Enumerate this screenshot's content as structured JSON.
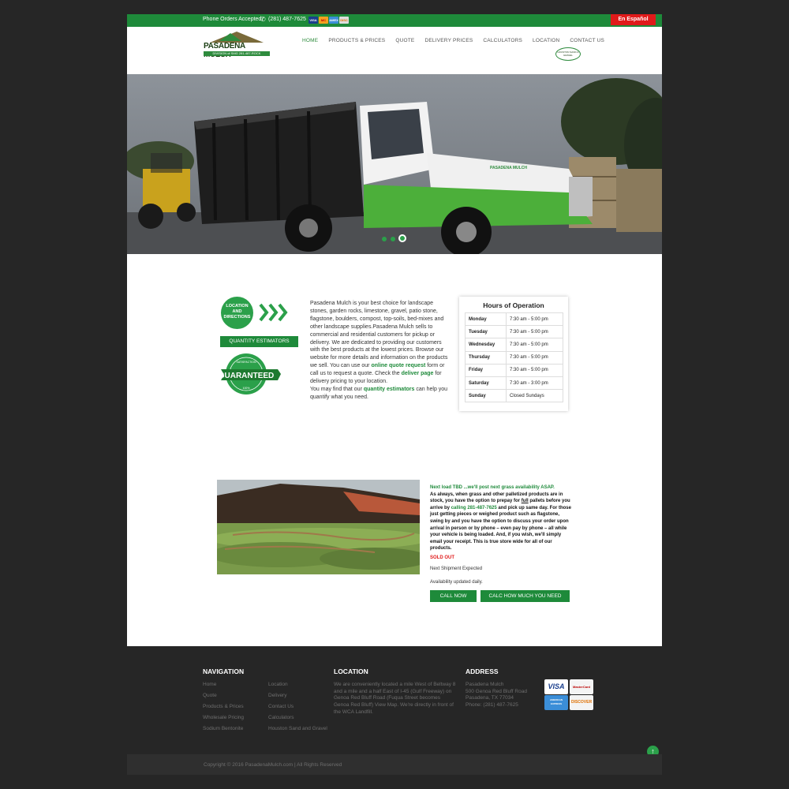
{
  "topbar": {
    "phone_label": "Phone Orders Accepted",
    "phone_number": "(281) 487-7625",
    "cards": [
      "VISA",
      "MC",
      "AMEX",
      "DISC"
    ],
    "spanish_link": "En Español"
  },
  "logo": {
    "name": "PASADENA MULCH",
    "sub": "DIVISION of SMG   281-487-ROCK"
  },
  "nav": {
    "items": [
      "HOME",
      "PRODUCTS & PRICES",
      "QUOTE",
      "DELIVERY PRICES",
      "CALCULATORS",
      "LOCATION",
      "CONTACT US"
    ],
    "badge": "HOUSTON SAND & GRAVEL"
  },
  "hero": {
    "truck_label": "PASADENA MULCH",
    "slides_count": 3,
    "active_slide": 3
  },
  "intro": {
    "location_button": "LOCATION AND DIRECTIONS",
    "quantity_button": "QUANTITY ESTIMATORS",
    "seal_top": "SATISFACTION",
    "seal_main": "GUARANTEED",
    "seal_bottom": "100%",
    "about_1": "Pasadena Mulch is your best choice for landscape stones, garden rocks, limestone, gravel, patio stone, flagstone, boulders, compost, top-soils, bed-mixes and other landscape supplies.Pasadena Mulch sells to commercial and residential customers for pickup or delivery. We are dedicated to providing our customers with the best products at the lowest prices. Browse our website for more details and information on the products we sell. You can use our ",
    "about_link_quote": "online quote request",
    "about_2": " form or call us to request a quote. Check the ",
    "about_link_deliver": "deliver page",
    "about_3": " for delivery pricing to your location.",
    "about_4": "You may find that our ",
    "about_link_qty": "quantity estimators",
    "about_5": " can help you quantify what you need."
  },
  "hours": {
    "title": "Hours of Operation",
    "rows": [
      {
        "day": "Monday",
        "time": "7:30 am - 5:00 pm"
      },
      {
        "day": "Tuesday",
        "time": "7:30 am - 5:00 pm"
      },
      {
        "day": "Wednesday",
        "time": "7:30 am - 5:00 pm"
      },
      {
        "day": "Thursday",
        "time": "7:30 am - 5:00 pm"
      },
      {
        "day": "Friday",
        "time": "7:30 am - 5:00 pm"
      },
      {
        "day": "Saturday",
        "time": "7:30 am - 3:00 pm"
      },
      {
        "day": "Sunday",
        "time": "Closed Sundays"
      }
    ]
  },
  "sod": {
    "next_load": "Next load TBD ...we'll post next grass availability ASAP.",
    "body_1": "As always, when grass and other palletized products are in stock, you have the option to prepay for ",
    "body_full": "full",
    "body_2": " pallets before you arrive by ",
    "body_calling": "calling 281-487-7625",
    "body_3": " and pick up same day.  For those just getting pieces or weighed product such as flagstone, swing by and you have the option to discuss your order upon arrival in person or by phone – even pay by phone – all while your vehicle is being loaded.  And, if you wish, we'll simply email your receipt.  This is true store wide for all of our products.",
    "sold_out": "SOLD OUT",
    "next_shipment": "Next Shipment Expected",
    "availability": "Availability updated daily.",
    "call_button": "CALL NOW",
    "calc_button": "CALC HOW MUCH YOU NEED"
  },
  "footer": {
    "nav_title": "NAVIGATION",
    "nav_col1": [
      "Home",
      "Quote",
      "Products & Prices",
      "Wholesale Pricing",
      "Sodium Bentonite"
    ],
    "nav_col2": [
      "Location",
      "Delivery",
      "Contact Us",
      "Calculators",
      "Houston Sand and Gravel"
    ],
    "location_title": "LOCATION",
    "location_text": "We are conveniently located a mile West of Beltway 8 and a mile and a half East of I-45 (Gulf Freeway) on Genoa Red Bluff Road (Fuqua Street becomes Genoa Red Bluff) View Map. We're directly in front of the WCA Landfill.",
    "address_title": "ADDRESS",
    "address_lines": [
      "Pasadena Mulch",
      "500 Genoa Red Bluff Road",
      "Pasadena, TX 77034",
      "Phone: (281) 487-7625"
    ],
    "cards": [
      "VISA",
      "MasterCard",
      "AMERICAN EXPRESS",
      "DISCOVER"
    ],
    "copyright": "Copyright © 2016 PasadenaMulch.com | All Rights Reserved"
  }
}
